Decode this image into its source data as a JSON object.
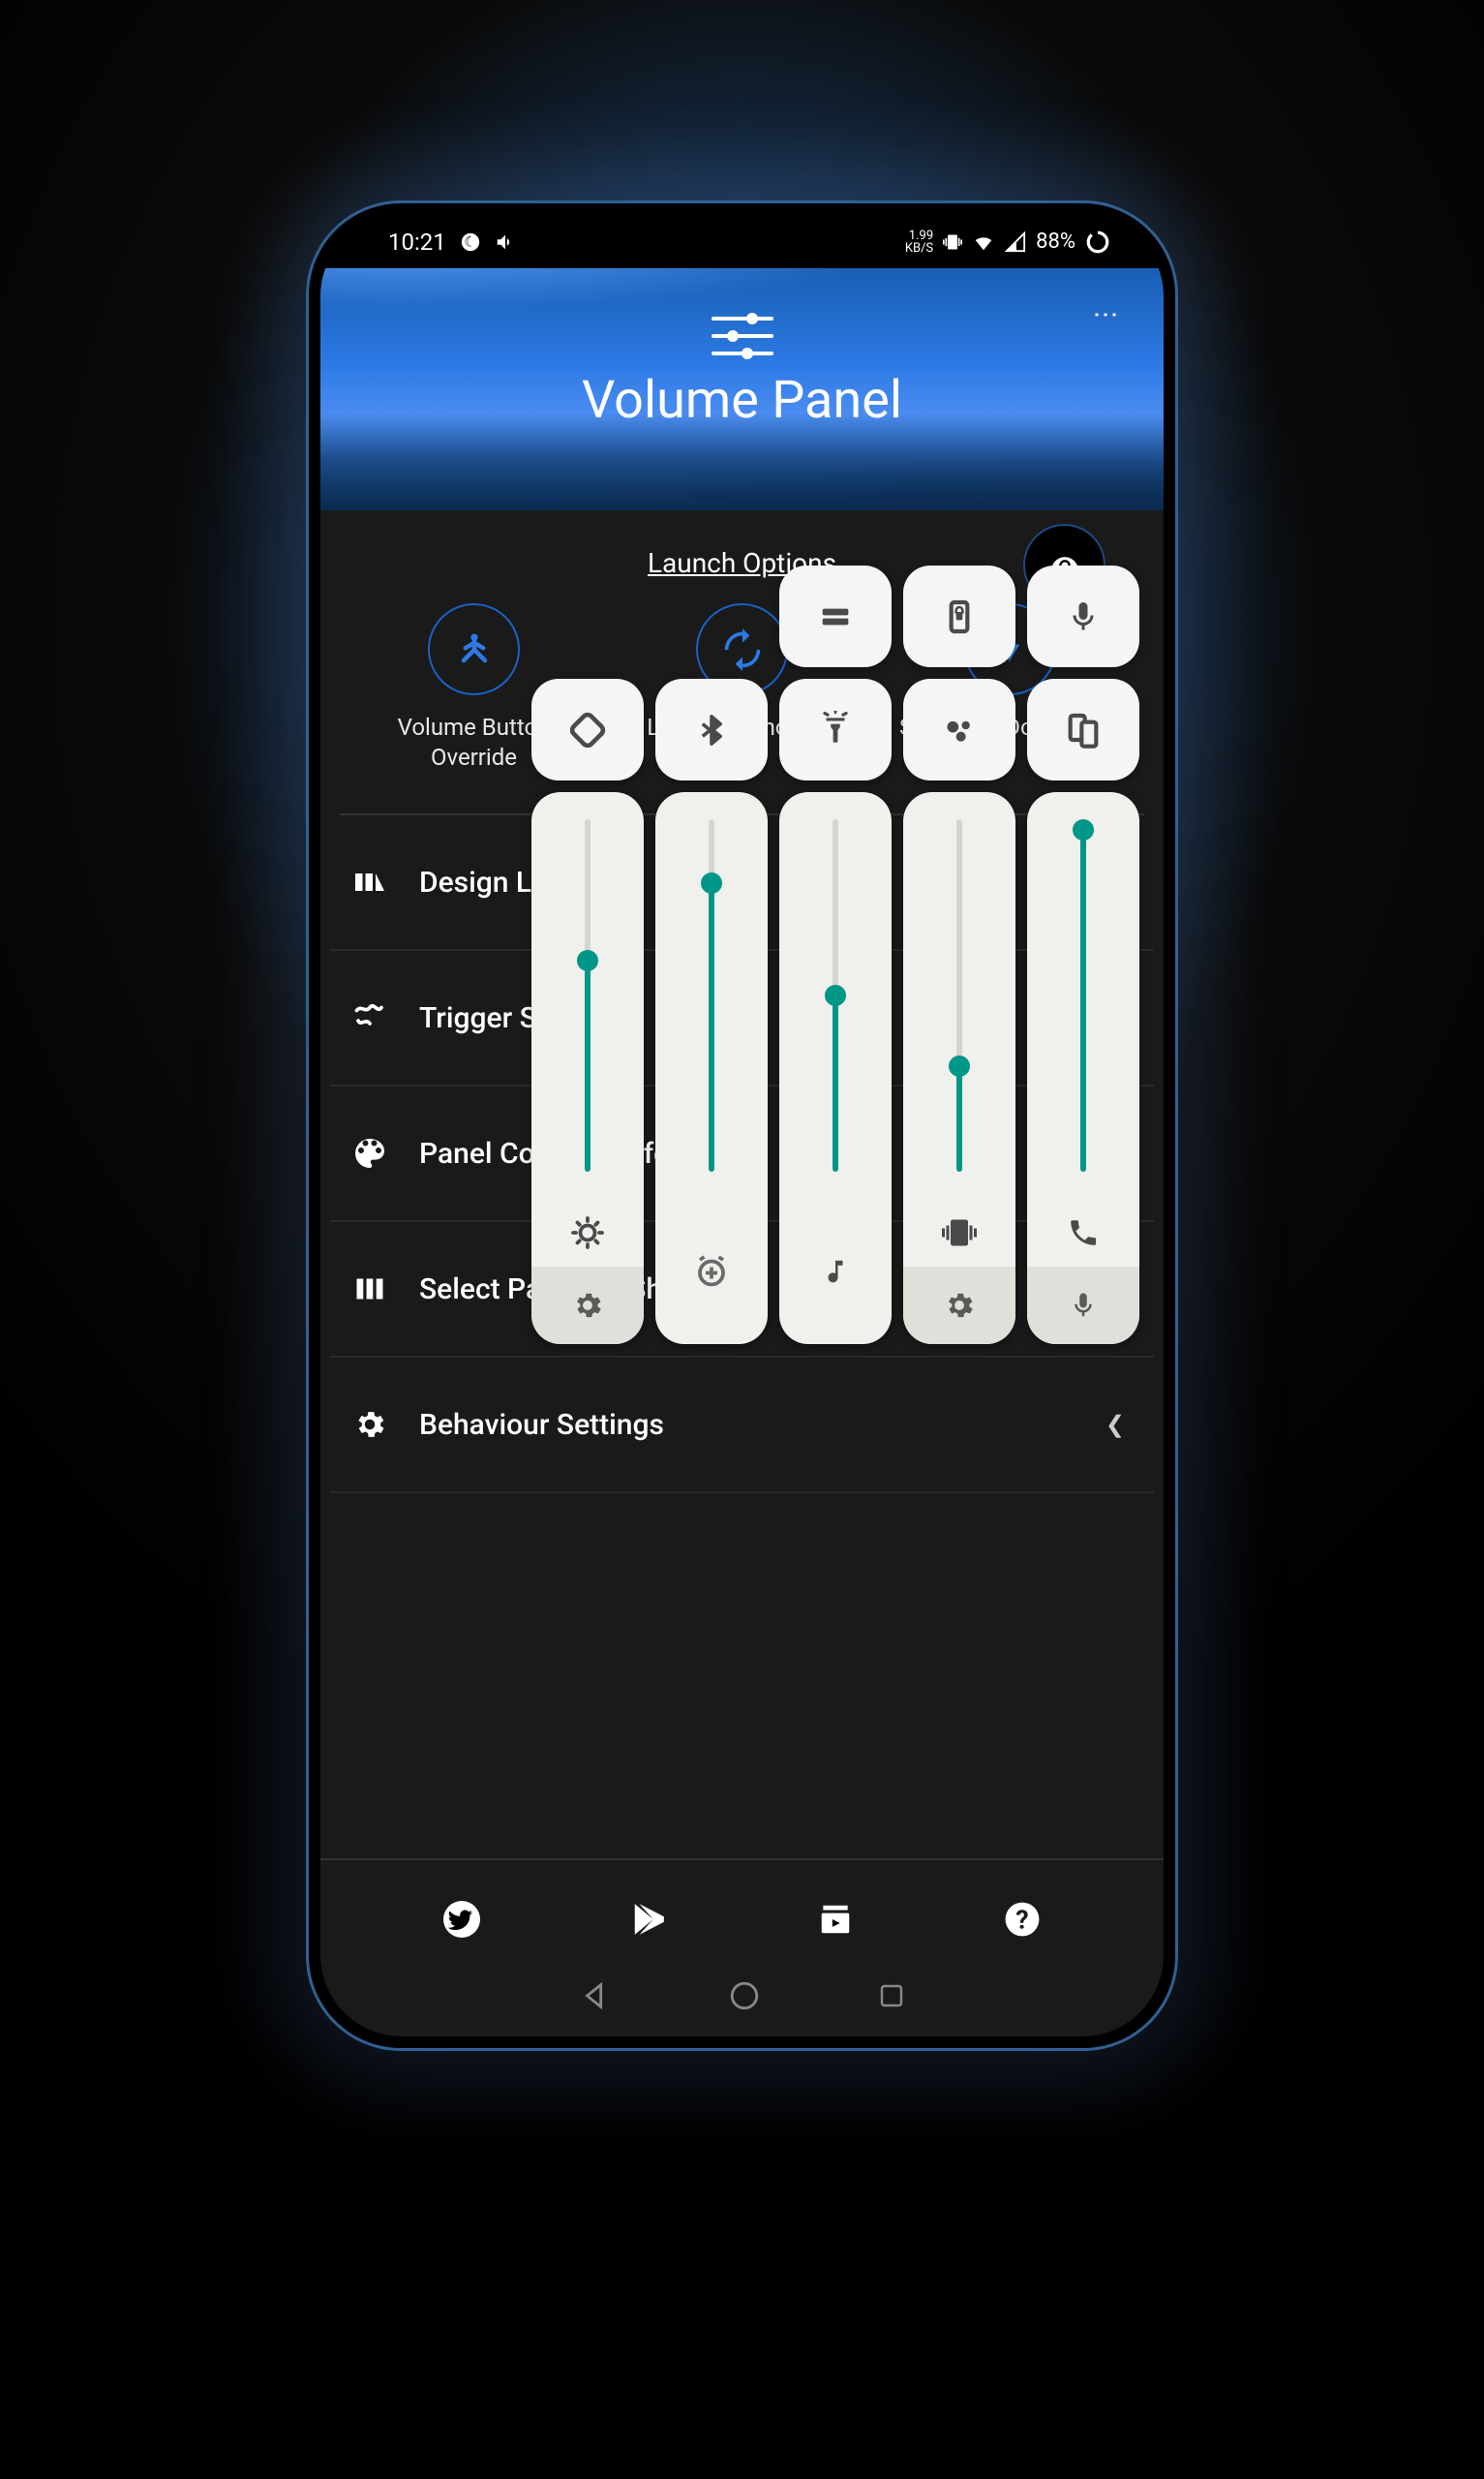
{
  "status": {
    "time": "10:21",
    "kbs_value": "1.99",
    "kbs_label": "KB/S",
    "battery": "88%"
  },
  "header": {
    "title": "Volume Panel"
  },
  "sections": {
    "launch_title": "Launch Options",
    "launch_items": [
      {
        "label": "Volume Button Override"
      },
      {
        "label": "Launcher Shortcut"
      },
      {
        "label": "Swipe Up/Down Edge"
      }
    ]
  },
  "menu": [
    {
      "label": "Design Layouts"
    },
    {
      "label": "Trigger Settings"
    },
    {
      "label": "Panel Colors & Effect"
    },
    {
      "label": "Select Panels & Shortcuts"
    },
    {
      "label": "Behaviour Settings"
    }
  ],
  "overlay": {
    "top_row": [
      {
        "name": "equals-icon"
      },
      {
        "name": "rotation-lock-icon"
      },
      {
        "name": "mic-icon"
      }
    ],
    "second_row": [
      {
        "name": "rotate-icon"
      },
      {
        "name": "bluetooth-icon"
      },
      {
        "name": "flashlight-icon"
      },
      {
        "name": "dots-icon"
      },
      {
        "name": "screens-icon"
      }
    ],
    "sliders": [
      {
        "percent": 60,
        "icon": "brightness-icon",
        "action": "gear-icon"
      },
      {
        "percent": 82,
        "icon": "alarm-plus-icon",
        "action": null
      },
      {
        "percent": 50,
        "icon": "music-note-icon",
        "action": null
      },
      {
        "percent": 30,
        "icon": "vibrate-icon",
        "action": "gear-icon"
      },
      {
        "percent": 97,
        "icon": "phone-icon",
        "action": "mic-icon"
      }
    ]
  }
}
